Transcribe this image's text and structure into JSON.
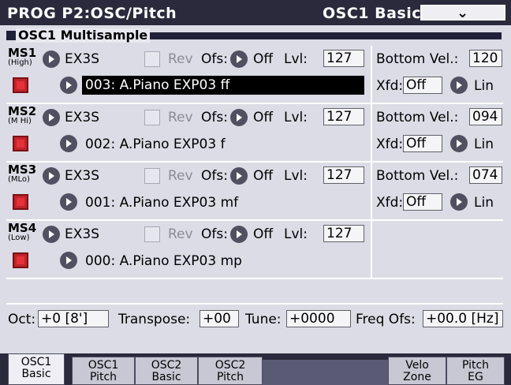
{
  "title": {
    "left": "PROG  P2:OSC/Pitch",
    "right": "OSC1 Basic",
    "menu_icon": "chevron-down-icon"
  },
  "group_label": "OSC1 Multisample",
  "ms": [
    {
      "name": "MS1",
      "sub": "(High)",
      "bank": "EX3S",
      "rev": "Rev",
      "ofs_label": "Ofs:",
      "ofs": "Off",
      "lvl_label": "Lvl:",
      "lvl": "127",
      "sample": "003: A.Piano EXP03 ff",
      "bottom_label": "Bottom Vel.:",
      "bottom": "120",
      "xfd_label": "Xfd:",
      "xfd": "Off",
      "curve": "Lin"
    },
    {
      "name": "MS2",
      "sub": "(M Hi)",
      "bank": "EX3S",
      "rev": "Rev",
      "ofs_label": "Ofs:",
      "ofs": "Off",
      "lvl_label": "Lvl:",
      "lvl": "127",
      "sample": "002: A.Piano EXP03 f",
      "bottom_label": "Bottom Vel.:",
      "bottom": "094",
      "xfd_label": "Xfd:",
      "xfd": "Off",
      "curve": "Lin"
    },
    {
      "name": "MS3",
      "sub": "(MLo)",
      "bank": "EX3S",
      "rev": "Rev",
      "ofs_label": "Ofs:",
      "ofs": "Off",
      "lvl_label": "Lvl:",
      "lvl": "127",
      "sample": "001: A.Piano EXP03 mf",
      "bottom_label": "Bottom Vel.:",
      "bottom": "074",
      "xfd_label": "Xfd:",
      "xfd": "Off",
      "curve": "Lin"
    },
    {
      "name": "MS4",
      "sub": "(Low)",
      "bank": "EX3S",
      "rev": "Rev",
      "ofs_label": "Ofs:",
      "ofs": "Off",
      "lvl_label": "Lvl:",
      "lvl": "127",
      "sample": "000: A.Piano EXP03 mp"
    }
  ],
  "pitch": {
    "oct_label": "Oct:",
    "oct": "+0 [8']",
    "transpose_label": "Transpose:",
    "transpose": "+00",
    "tune_label": "Tune:",
    "tune": "+0000",
    "freq_label": "Freq Ofs:",
    "freq": "+00.0 [Hz]"
  },
  "tabs": [
    {
      "l1": "OSC1",
      "l2": "Basic"
    },
    {
      "l1": "OSC1",
      "l2": "Pitch"
    },
    {
      "l1": "OSC2",
      "l2": "Basic"
    },
    {
      "l1": "OSC2",
      "l2": "Pitch"
    },
    {
      "l1": "Velo",
      "l2": "Zone"
    },
    {
      "l1": "Pitch",
      "l2": "EG"
    }
  ],
  "colors": {
    "title_bg": "#2a2a3c",
    "panel_bg": "#dcdce6",
    "select_bg": "#000000",
    "red_button": "#c0242c"
  }
}
